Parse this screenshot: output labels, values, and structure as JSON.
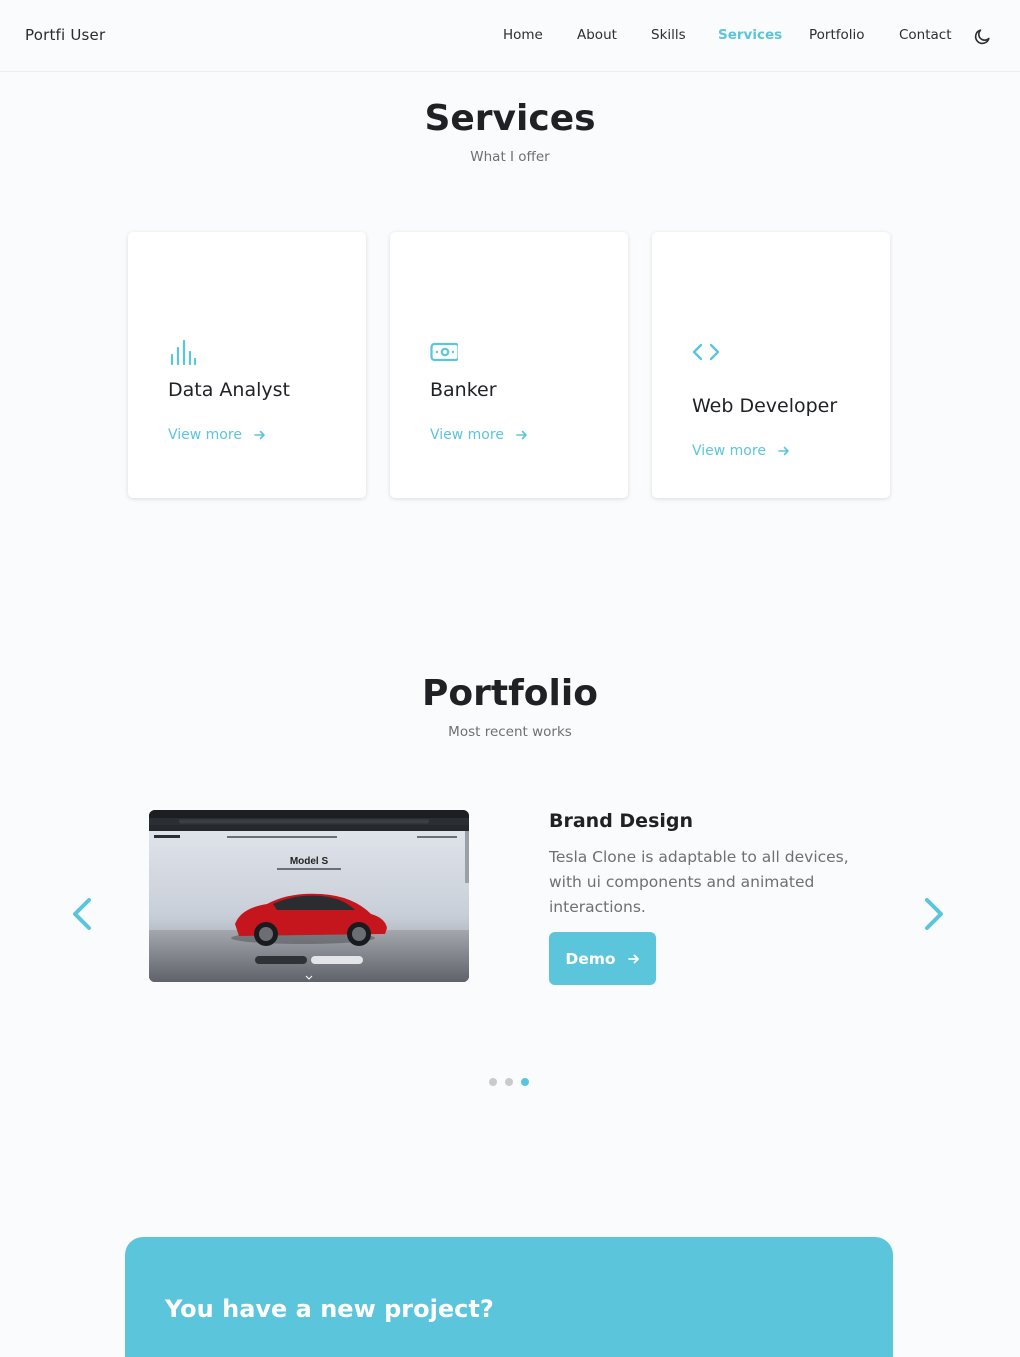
{
  "header": {
    "logo": "Portfi User",
    "nav": [
      "Home",
      "About",
      "Skills",
      "Services",
      "Portfolio",
      "Contact"
    ],
    "active_nav": "Services",
    "theme_icon": "moon-icon"
  },
  "services": {
    "title": "Services",
    "subtitle": "What I offer",
    "cards": [
      {
        "icon": "bar-chart-icon",
        "title": "Data Analyst",
        "link": "View more"
      },
      {
        "icon": "money-bill-icon",
        "title": "Banker",
        "link": "View more"
      },
      {
        "icon": "code-icon",
        "title": "Web Developer",
        "link": "View more"
      }
    ]
  },
  "portfolio": {
    "title": "Portfolio",
    "subtitle": "Most recent works",
    "item": {
      "title": "Brand Design",
      "description": "Tesla Clone is adaptable to all devices, with ui components and animated interactions.",
      "button": "Demo",
      "screenshot": {
        "heading": "Model S",
        "logo": "TESLA"
      }
    },
    "pages": 3,
    "current_page": 3
  },
  "banner": {
    "title": "You have a new project?"
  },
  "colors": {
    "accent": "#5bc5dc",
    "text": "#1f2124",
    "muted": "#6d7074",
    "background": "#fafbfd"
  }
}
